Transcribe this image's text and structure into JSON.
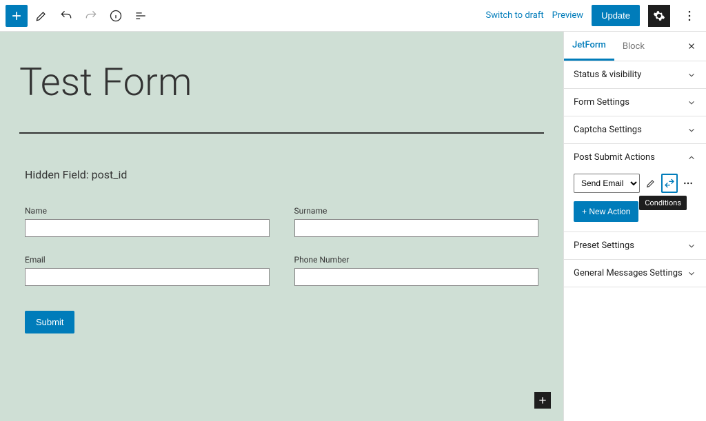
{
  "toolbar": {
    "switch_draft": "Switch to draft",
    "preview": "Preview",
    "update": "Update"
  },
  "editor": {
    "title": "Test Form",
    "hidden_field_label": "Hidden Field: post_id",
    "fields": {
      "name": "Name",
      "surname": "Surname",
      "email": "Email",
      "phone": "Phone Number"
    },
    "submit": "Submit"
  },
  "sidebar": {
    "tabs": {
      "jetform": "JetForm",
      "block": "Block"
    },
    "panels": {
      "status": "Status & visibility",
      "form_settings": "Form Settings",
      "captcha": "Captcha Settings",
      "post_submit": "Post Submit Actions",
      "preset": "Preset Settings",
      "general_messages": "General Messages Settings"
    },
    "post_submit": {
      "action_selected": "Send Email",
      "tooltip": "Conditions",
      "new_action": "+ New Action"
    }
  }
}
